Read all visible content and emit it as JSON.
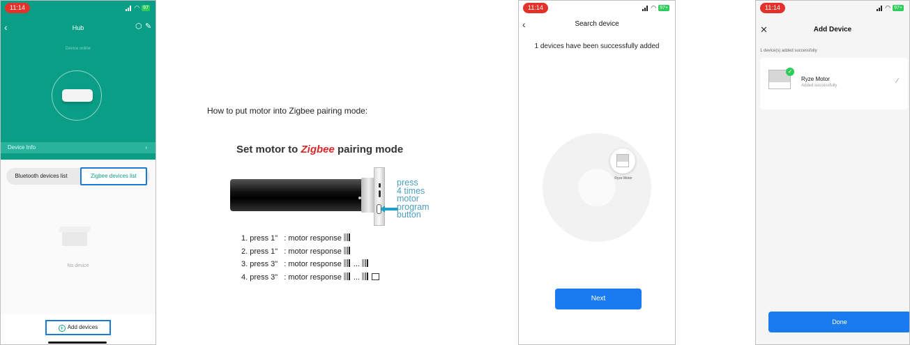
{
  "status_bar": {
    "time": "11:14",
    "battery": "97+",
    "battery_alt": "97"
  },
  "hub_screen": {
    "title": "Hub",
    "status": "Device online",
    "device_info": "Device Info",
    "tabs": [
      "Bluetooth devices list",
      "Zigbee devices list"
    ],
    "empty": "No device",
    "add_button": "Add devices"
  },
  "instructions": {
    "heading": "How to put motor into Zigbee pairing mode:",
    "image_title_pre": "Set motor to ",
    "image_title_em": "Zigbee",
    "image_title_post": " pairing mode",
    "callout": [
      "press",
      "4 times",
      "motor",
      "program",
      "button"
    ],
    "steps": [
      {
        "label": "1. press 1\"",
        "response": ": motor response"
      },
      {
        "label": "2. press 1\"",
        "response": ": motor response"
      },
      {
        "label": "3. press 3\"",
        "response": ": motor response",
        "suffix": "..."
      },
      {
        "label": "4. press 3\"",
        "response": ": motor response",
        "suffix": "..."
      }
    ]
  },
  "search_screen": {
    "title": "Search device",
    "message": "1 devices have been successfully added",
    "device_label": "Ryze Motor",
    "next_button": "Next"
  },
  "add_screen": {
    "title": "Add Device",
    "message": "1 device(s) added successfully",
    "device_name": "Ryze Motor",
    "device_status": "Added successfully",
    "done_button": "Done"
  }
}
